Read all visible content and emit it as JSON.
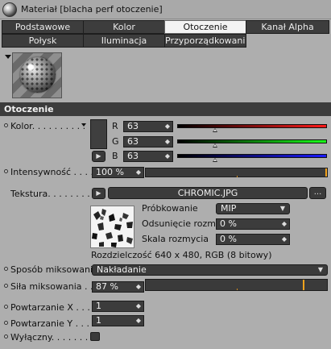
{
  "window": {
    "title": "Materiał [blacha perf otoczenie]"
  },
  "tabs": [
    {
      "label": "Podstawowe",
      "active": false
    },
    {
      "label": "Kolor",
      "active": false
    },
    {
      "label": "Otoczenie",
      "active": true
    },
    {
      "label": "Kanał Alpha",
      "active": false
    },
    {
      "label": "Połysk",
      "active": false
    },
    {
      "label": "Iluminacja",
      "active": false
    },
    {
      "label": "Przyporządkowanie",
      "active": false
    }
  ],
  "section": {
    "title": "Otoczenie"
  },
  "color": {
    "label": "Kolor. . . . . . . . . .",
    "swatch": "#3f3f3f",
    "channels": [
      {
        "name": "R",
        "value": "63",
        "fraction": 0.25,
        "gradient_end": "#ff1a1a"
      },
      {
        "name": "G",
        "value": "63",
        "fraction": 0.25,
        "gradient_end": "#1aff1a"
      },
      {
        "name": "B",
        "value": "63",
        "fraction": 0.25,
        "gradient_end": "#1a1aff"
      }
    ]
  },
  "intensity": {
    "label": "Intensywność . . . . .",
    "value": "100 %",
    "fraction": 1.0
  },
  "texture": {
    "label": "Tekstura. . . . . . . . .",
    "file": "CHROMIC.JPG",
    "more": "...",
    "sampling_label": "Próbkowanie",
    "sampling_value": "MIP",
    "blur_offset_label": "Odsunięcie rozmycia",
    "blur_offset_value": "0 %",
    "blur_scale_label": "Skala rozmycia",
    "blur_scale_value": "0 %",
    "resolution": "Rozdzielczość 640 x 480, RGB (8 bitowy)"
  },
  "mix_mode": {
    "label": "Sposób miksowania",
    "value": "Nakładanie"
  },
  "mix_strength": {
    "label": "Siła miksowania . . .",
    "value": "87 %",
    "fraction": 0.87
  },
  "repeat_x": {
    "label": "Powtarzanie X . . .",
    "value": "1"
  },
  "repeat_y": {
    "label": "Powtarzanie Y . . . .",
    "value": "1"
  },
  "exclusive": {
    "label": "Wyłączny. . . . . . . . ."
  },
  "colors": {
    "accent": "#f2a21d",
    "panel": "#aeaeae",
    "field": "#3c3c3c"
  }
}
